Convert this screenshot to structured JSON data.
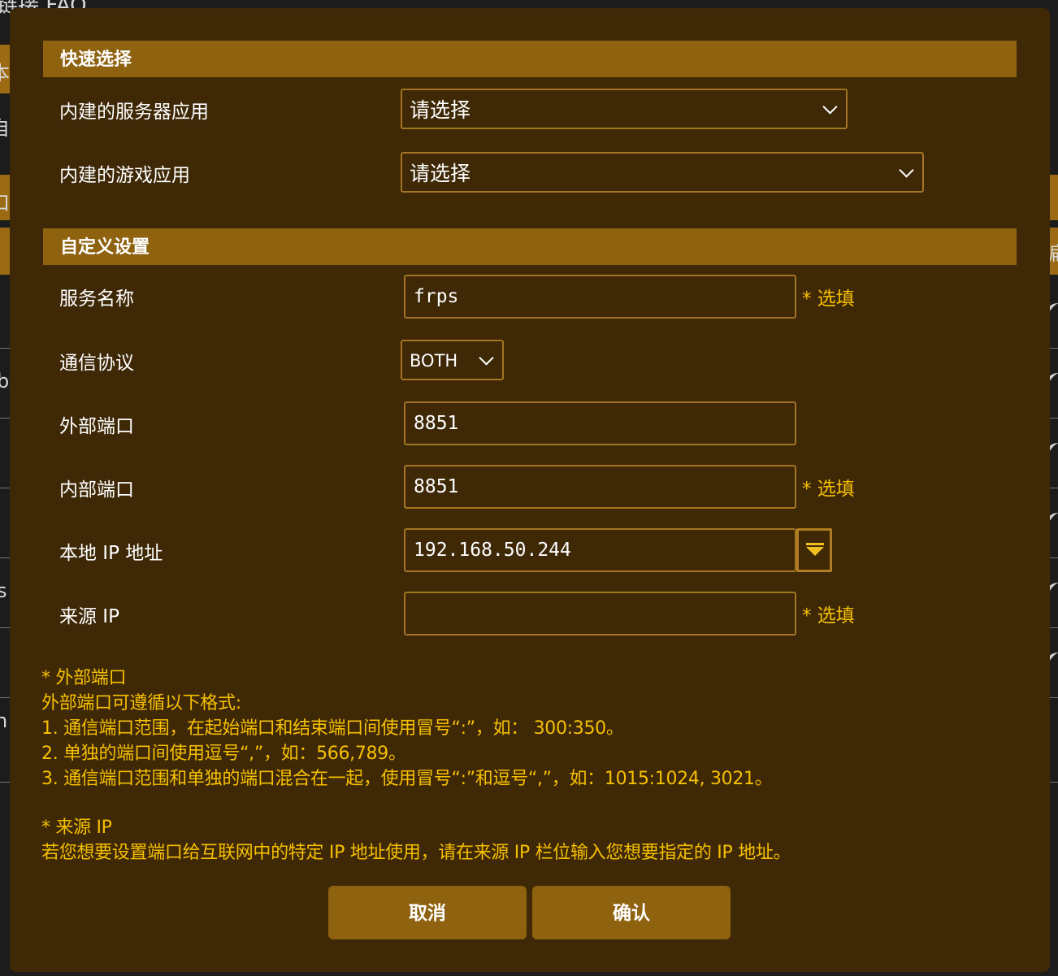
{
  "background": {
    "top_text": "链接 FAQ",
    "left_chars": [
      "本",
      "自",
      "口",
      "b",
      "s",
      "n"
    ],
    "right_chars": [
      "扁"
    ]
  },
  "quick_select": {
    "header": "快速选择",
    "server_app": {
      "label": "内建的服务器应用",
      "value": "请选择"
    },
    "game_app": {
      "label": "内建的游戏应用",
      "value": "请选择"
    }
  },
  "custom_settings": {
    "header": "自定义设置",
    "service_name": {
      "label": "服务名称",
      "value": "frps",
      "note": "* 选填"
    },
    "protocol": {
      "label": "通信协议",
      "value": "BOTH"
    },
    "external_port": {
      "label": "外部端口",
      "value": "8851"
    },
    "internal_port": {
      "label": "内部端口",
      "value": "8851",
      "note": "* 选填"
    },
    "local_ip": {
      "label": "本地 IP 地址",
      "value": "192.168.50.244"
    },
    "source_ip": {
      "label": "来源 IP",
      "value": "",
      "note": "* 选填"
    }
  },
  "notes": {
    "external_title": "* 外部端口",
    "external_intro": "外部端口可遵循以下格式:",
    "external_1": "1. 通信端口范围，在起始端口和结束端口间使用冒号“:”，如： 300:350。",
    "external_2": "2. 单独的端口间使用逗号“,”，如：566,789。",
    "external_3": "3. 通信端口范围和单独的端口混合在一起，使用冒号“:”和逗号“,”，如：1015:1024, 3021。",
    "source_title": "* 来源 IP",
    "source_desc": "若您想要设置端口给互联网中的特定 IP 地址使用，请在来源 IP 栏位输入您想要指定的 IP 地址。"
  },
  "buttons": {
    "cancel": "取消",
    "confirm": "确认"
  },
  "colors": {
    "modal_bg": "#3e2806",
    "header_bg": "#8f6210",
    "border": "#a37523",
    "note_text": "#f6c000"
  },
  "icons": {
    "select_chevron": "chevron-down-icon",
    "ip_dropdown": "triangle-down-icon"
  }
}
